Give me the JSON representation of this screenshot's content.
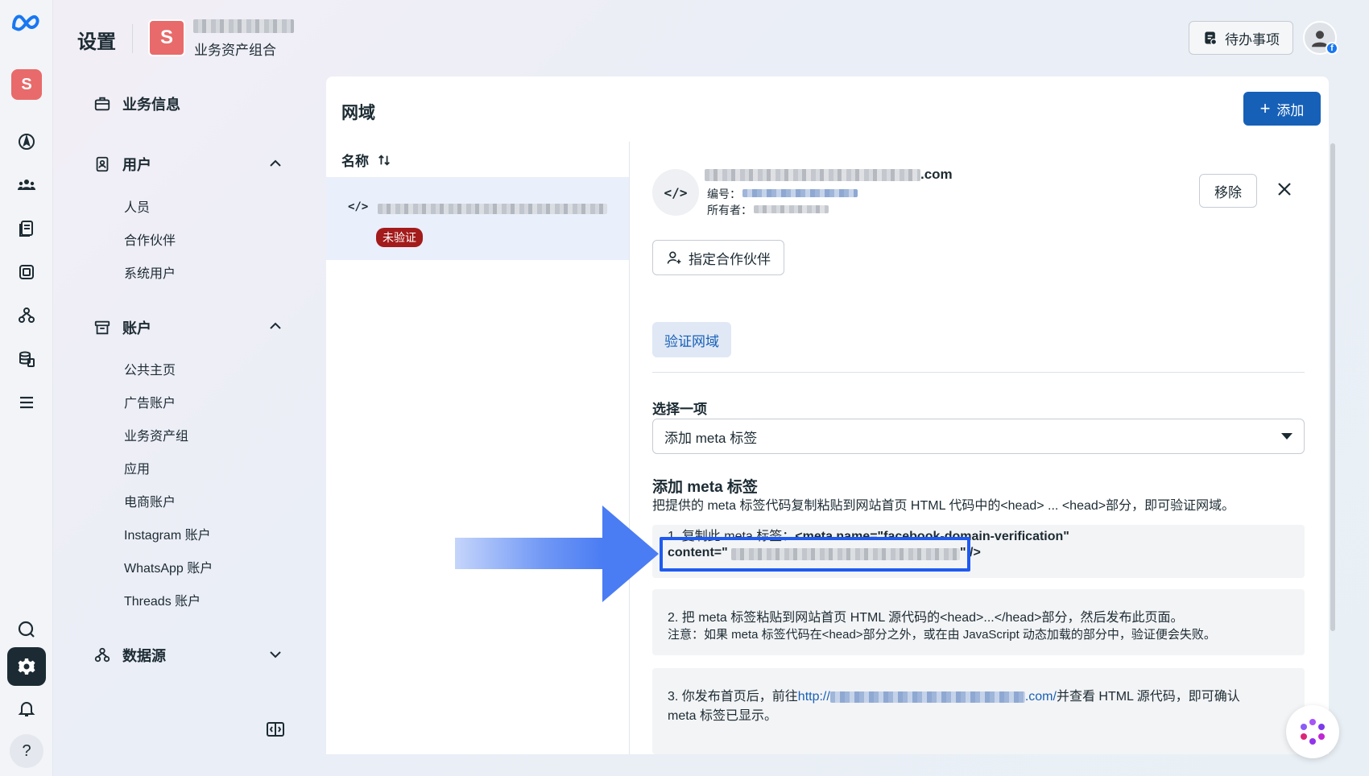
{
  "header": {
    "title": "设置",
    "business_initial": "S",
    "business_subtitle": "业务资产组合",
    "todo_label": "待办事项"
  },
  "rail": {
    "avatar_initial": "S",
    "help_label": "?"
  },
  "sidebar": {
    "business_info": "业务信息",
    "users_section": "用户",
    "users_items": [
      "人员",
      "合作伙伴",
      "系统用户"
    ],
    "accounts_section": "账户",
    "accounts_items": [
      "公共主页",
      "广告账户",
      "业务资产组",
      "应用",
      "电商账户",
      "Instagram 账户",
      "WhatsApp 账户",
      "Threads 账户"
    ],
    "data_sources": "数据源"
  },
  "panel": {
    "title": "网域",
    "add_label": "添加",
    "list_header": "名称",
    "unverified_badge": "未验证"
  },
  "detail": {
    "domain_suffix": ".com",
    "id_label": "编号：",
    "owner_label": "所有者：",
    "remove_label": "移除",
    "assign_partner_label": "指定合作伙伴",
    "verify_tab_label": "验证网域",
    "select_label": "选择一项",
    "select_value": "添加 meta 标签",
    "section_title": "添加 meta 标签",
    "section_desc": "把提供的 meta 标签代码复制粘贴到网站首页 HTML 代码中的<head> ... <head>部分，即可验证网域。",
    "step1_prefix": "1. 复制此 meta 标签：",
    "step1_tag": "<meta name=\"facebook-domain-verification\"",
    "step1_content_prefix": "content=\"",
    "step1_content_suffix": "\" />",
    "step2_line1": "2. 把 meta 标签粘贴到网站首页 HTML 源代码的<head>...</head>部分，然后发布此页面。",
    "step2_line2": "注意：如果 meta 标签代码在<head>部分之外，或在由 JavaScript 动态加载的部分中，验证便会失败。",
    "step3_prefix": "3. 你发布首页后，前往",
    "step3_link_start": "http://",
    "step3_link_end": ".com/",
    "step3_suffix": "并查看 HTML 源代码，即可确认",
    "step3_line2": "meta 标签已显示。"
  },
  "colors": {
    "primary": "#1660b8",
    "badge_red": "#a31b1b",
    "highlight": "#1f5bf0",
    "avatar_red": "#e96a6a"
  }
}
